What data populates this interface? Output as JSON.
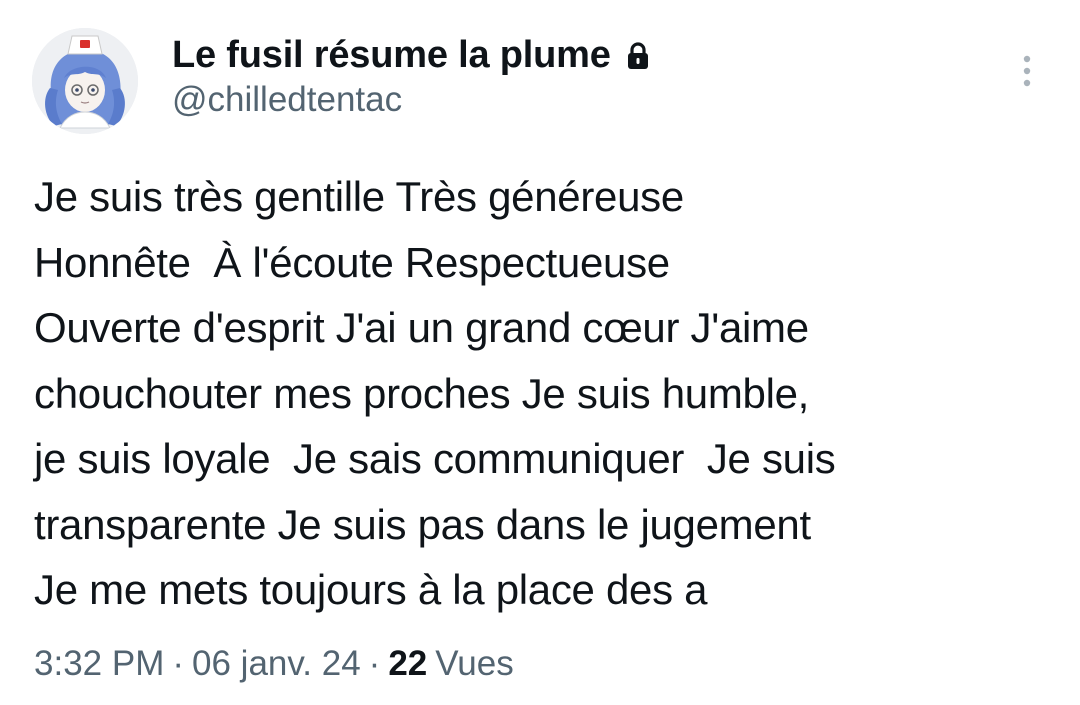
{
  "author": {
    "display_name": "Le fusil résume la plume",
    "handle": "@chilledtentac",
    "protected_icon": "lock-icon",
    "avatar": "anime-style character with blue hair and white cap"
  },
  "tweet": {
    "lines": [
      "Je suis très gentille Très généreuse",
      "Honnête  À l'écoute Respectueuse",
      "Ouverte d'esprit J'ai un grand cœur J'aime",
      "chouchouter mes proches Je suis humble,",
      "je suis loyale  Je sais communiquer  Je suis",
      "transparente Je suis pas dans le jugement",
      "Je me mets toujours à la place des a"
    ]
  },
  "meta": {
    "time": "3:32 PM",
    "separator": "·",
    "date": "06 janv. 24",
    "views_count": "22",
    "views_label": "Vues"
  },
  "icons": {
    "more": "more-vertical-icon"
  },
  "colors": {
    "text_primary": "#0f1419",
    "text_secondary": "#536471",
    "background": "#ffffff"
  }
}
